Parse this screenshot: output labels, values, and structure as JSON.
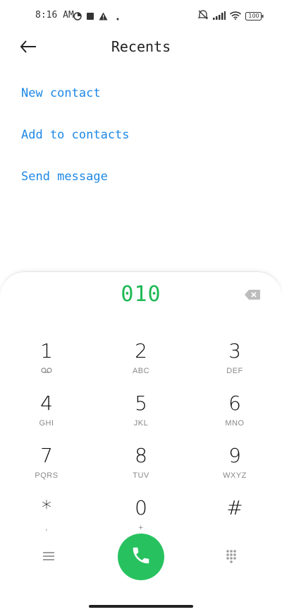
{
  "status_bar": {
    "time": "8:16 AM",
    "battery": "100",
    "left_icons": [
      "data-saver-icon",
      "square-notification-icon",
      "warning-icon",
      "dot-icon"
    ],
    "right_icons": [
      "mute-vibrate-icon",
      "signal-icon",
      "wifi-icon",
      "battery-icon"
    ]
  },
  "header": {
    "title": "Recents",
    "back_icon": "arrow-left-icon"
  },
  "actions": [
    {
      "label": "New contact"
    },
    {
      "label": "Add to contacts"
    },
    {
      "label": "Send message"
    }
  ],
  "dialer": {
    "number": "010",
    "backspace_icon": "backspace-icon",
    "keys": [
      {
        "digit": "1",
        "letters": "",
        "sub_icon": "voicemail-icon"
      },
      {
        "digit": "2",
        "letters": "ABC"
      },
      {
        "digit": "3",
        "letters": "DEF"
      },
      {
        "digit": "4",
        "letters": "GHI"
      },
      {
        "digit": "5",
        "letters": "JKL"
      },
      {
        "digit": "6",
        "letters": "MNO"
      },
      {
        "digit": "7",
        "letters": "PQRS"
      },
      {
        "digit": "8",
        "letters": "TUV"
      },
      {
        "digit": "9",
        "letters": "WXYZ"
      },
      {
        "digit": "*",
        "letters": ","
      },
      {
        "digit": "0",
        "letters": "+"
      },
      {
        "digit": "#",
        "letters": ""
      }
    ],
    "bottom": {
      "menu_icon": "menu-icon",
      "call_icon": "phone-icon",
      "keypad_icon": "keypad-icon"
    }
  },
  "colors": {
    "accent_blue": "#1e88e5",
    "number_green": "#1db954",
    "call_green": "#27c25f"
  }
}
